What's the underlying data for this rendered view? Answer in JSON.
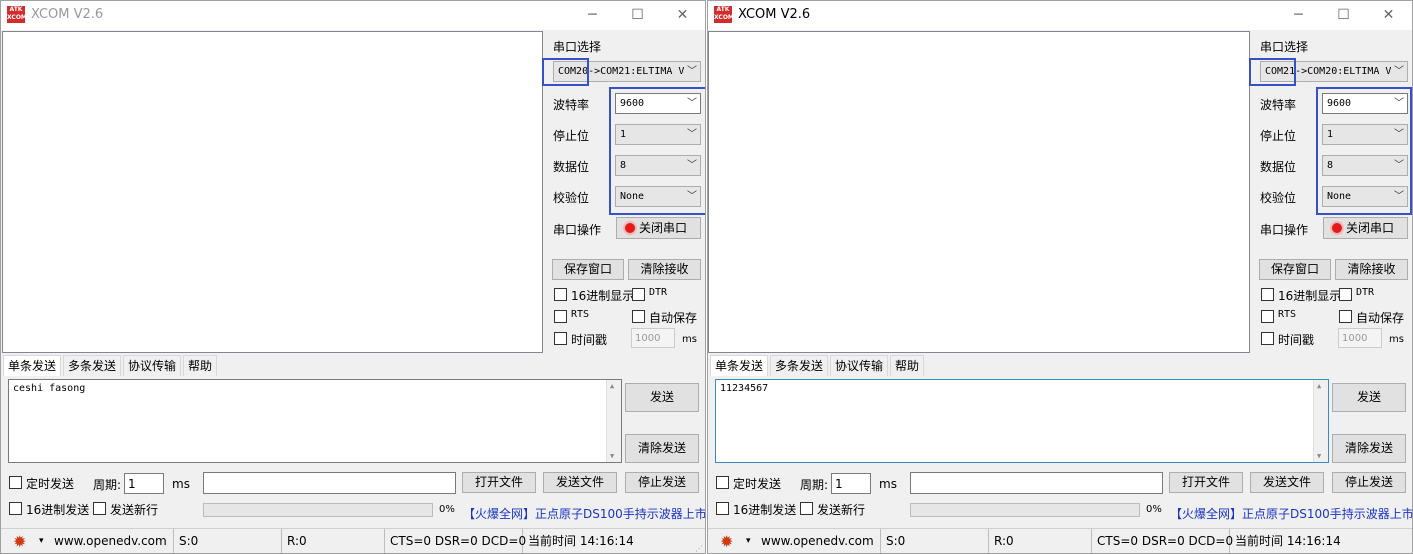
{
  "windows": [
    {
      "id": "left",
      "title": "XCOM V2.6",
      "logo_text_top": "ATK",
      "logo_text_bottom": "XCOM",
      "serial_select_label": "串口选择",
      "port_value": "COM20->COM21:ELTIMA V",
      "baud_label": "波特率",
      "baud_value": "9600",
      "stop_label": "停止位",
      "stop_value": "1",
      "data_label": "数据位",
      "data_value": "8",
      "parity_label": "校验位",
      "parity_value": "None",
      "op_label": "串口操作",
      "op_button": "关闭串口",
      "save_window": "保存窗口",
      "clear_recv": "清除接收",
      "hex_display": "16进制显示",
      "dtr": "DTR",
      "rts": "RTS",
      "auto_save": "自动保存",
      "timestamp": "时间戳",
      "timestamp_value": "1000",
      "ms": "ms",
      "tabs": [
        "单条发送",
        "多条发送",
        "协议传输",
        "帮助"
      ],
      "send_text": "ceshi fasong",
      "send_button": "发送",
      "clear_send": "清除发送",
      "timed_send": "定时发送",
      "period_label": "周期:",
      "period_value": "1",
      "open_file": "打开文件",
      "send_file": "发送文件",
      "stop_send": "停止发送",
      "hex_send": "16进制发送",
      "send_newline": "发送新行",
      "progress_text": "0%",
      "ad_link": "【火爆全网】正点原子DS100手持示波器上市",
      "status_url": "www.openedv.com",
      "status_s": "S:0",
      "status_r": "R:0",
      "status_lines": "CTS=0 DSR=0 DCD=0",
      "status_time": "当前时间 14:16:14"
    },
    {
      "id": "right",
      "title": "XCOM V2.6",
      "logo_text_top": "ATK",
      "logo_text_bottom": "XCOM",
      "serial_select_label": "串口选择",
      "port_value": "COM21->COM20:ELTIMA V",
      "baud_label": "波特率",
      "baud_value": "9600",
      "stop_label": "停止位",
      "stop_value": "1",
      "data_label": "数据位",
      "data_value": "8",
      "parity_label": "校验位",
      "parity_value": "None",
      "op_label": "串口操作",
      "op_button": "关闭串口",
      "save_window": "保存窗口",
      "clear_recv": "清除接收",
      "hex_display": "16进制显示",
      "dtr": "DTR",
      "rts": "RTS",
      "auto_save": "自动保存",
      "timestamp": "时间戳",
      "timestamp_value": "1000",
      "ms": "ms",
      "tabs": [
        "单条发送",
        "多条发送",
        "协议传输",
        "帮助"
      ],
      "send_text": "11234567",
      "send_button": "发送",
      "clear_send": "清除发送",
      "timed_send": "定时发送",
      "period_label": "周期:",
      "period_value": "1",
      "open_file": "打开文件",
      "send_file": "发送文件",
      "stop_send": "停止发送",
      "hex_send": "16进制发送",
      "send_newline": "发送新行",
      "progress_text": "0%",
      "ad_link": "【火爆全网】正点原子DS100手持示波器上市",
      "status_url": "www.openedv.com",
      "status_s": "S:0",
      "status_r": "R:0",
      "status_lines": "CTS=0 DSR=0 DCD=0",
      "status_time": "当前时间 14:16:14"
    }
  ],
  "icons": {
    "minimize": "─",
    "maximize": "☐",
    "close": "✕",
    "dropdown": "﹀",
    "gear": "✹",
    "dropdown_small": "▾"
  },
  "colors": {
    "highlight_box": "#3553c7",
    "link": "#1a34c9",
    "record_red": "#e11b1b"
  }
}
